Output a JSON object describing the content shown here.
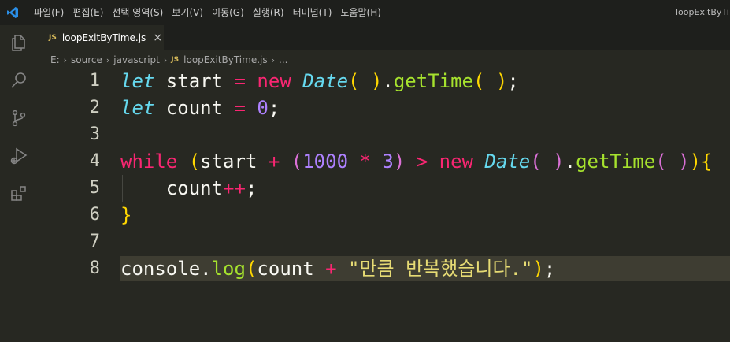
{
  "menu": [
    "파일(F)",
    "편집(E)",
    "선택 영역(S)",
    "보기(V)",
    "이동(G)",
    "실행(R)",
    "터미널(T)",
    "도움말(H)"
  ],
  "window_title": "loopExitByTi",
  "activity_icons": [
    "explorer-icon",
    "search-icon",
    "source-control-icon",
    "run-debug-icon",
    "extensions-icon"
  ],
  "tab": {
    "badge": "JS",
    "label": "loopExitByTime.js",
    "close": "×"
  },
  "breadcrumb": {
    "parts": [
      "E:",
      "source",
      "javascript"
    ],
    "file_badge": "JS",
    "file": "loopExitByTime.js",
    "tail": "..."
  },
  "colors": {
    "background": "#272822",
    "keyword": "#f92672",
    "function": "#a6e22e",
    "type": "#66d9ef",
    "number": "#ae81ff",
    "string": "#e6db74"
  },
  "editor": {
    "lines": [
      {
        "n": "1",
        "tokens": [
          [
            "let",
            "t-kw-it"
          ],
          [
            " start ",
            "t-plain"
          ],
          [
            "=",
            "t-op"
          ],
          [
            " ",
            "t-plain"
          ],
          [
            "new",
            "t-kw"
          ],
          [
            " ",
            "t-plain"
          ],
          [
            "Date",
            "t-cls"
          ],
          [
            "(",
            "t-p1"
          ],
          [
            " ",
            "t-plain"
          ],
          [
            ")",
            "t-p1"
          ],
          [
            ".",
            "t-plain"
          ],
          [
            "getTime",
            "t-fn"
          ],
          [
            "(",
            "t-p1"
          ],
          [
            " ",
            "t-plain"
          ],
          [
            ")",
            "t-p1"
          ],
          [
            ";",
            "t-plain"
          ]
        ]
      },
      {
        "n": "2",
        "tokens": [
          [
            "let",
            "t-kw-it"
          ],
          [
            " count ",
            "t-plain"
          ],
          [
            "=",
            "t-op"
          ],
          [
            " ",
            "t-plain"
          ],
          [
            "0",
            "t-num"
          ],
          [
            ";",
            "t-plain"
          ]
        ]
      },
      {
        "n": "3",
        "tokens": []
      },
      {
        "n": "4",
        "tokens": [
          [
            "while",
            "t-kw"
          ],
          [
            " ",
            "t-plain"
          ],
          [
            "(",
            "t-p1"
          ],
          [
            "start ",
            "t-plain"
          ],
          [
            "+",
            "t-op"
          ],
          [
            " ",
            "t-plain"
          ],
          [
            "(",
            "t-p2"
          ],
          [
            "1000",
            "t-num"
          ],
          [
            " ",
            "t-plain"
          ],
          [
            "*",
            "t-op"
          ],
          [
            " ",
            "t-plain"
          ],
          [
            "3",
            "t-num"
          ],
          [
            ")",
            "t-p2"
          ],
          [
            " ",
            "t-plain"
          ],
          [
            ">",
            "t-op"
          ],
          [
            " ",
            "t-plain"
          ],
          [
            "new",
            "t-kw"
          ],
          [
            " ",
            "t-plain"
          ],
          [
            "Date",
            "t-cls"
          ],
          [
            "(",
            "t-p2"
          ],
          [
            " ",
            "t-plain"
          ],
          [
            ")",
            "t-p2"
          ],
          [
            ".",
            "t-plain"
          ],
          [
            "getTime",
            "t-fn"
          ],
          [
            "(",
            "t-p2"
          ],
          [
            " ",
            "t-plain"
          ],
          [
            ")",
            "t-p2"
          ],
          [
            ")",
            "t-p1"
          ],
          [
            "{",
            "t-p1"
          ]
        ]
      },
      {
        "n": "5",
        "tokens": [
          [
            "    count",
            "t-plain"
          ],
          [
            "++",
            "t-op"
          ],
          [
            ";",
            "t-plain"
          ]
        ]
      },
      {
        "n": "6",
        "tokens": [
          [
            "}",
            "t-p1"
          ]
        ]
      },
      {
        "n": "7",
        "tokens": []
      },
      {
        "n": "8",
        "tokens": [
          [
            "console",
            "t-plain"
          ],
          [
            ".",
            "t-plain"
          ],
          [
            "log",
            "t-fn"
          ],
          [
            "(",
            "t-p1"
          ],
          [
            "count ",
            "t-plain"
          ],
          [
            "+",
            "t-op"
          ],
          [
            " ",
            "t-plain"
          ],
          [
            "\"만큼 반복했습니다.\"",
            "t-str"
          ],
          [
            ")",
            "t-p1"
          ],
          [
            ";",
            "t-plain"
          ]
        ]
      }
    ]
  }
}
